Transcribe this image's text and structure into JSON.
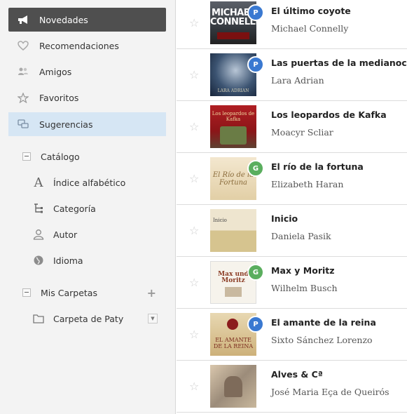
{
  "sidebar": {
    "nav": [
      {
        "label": "Novedades",
        "icon": "megaphone-icon"
      },
      {
        "label": "Recomendaciones",
        "icon": "heart-icon"
      },
      {
        "label": "Amigos",
        "icon": "users-icon"
      },
      {
        "label": "Favoritos",
        "icon": "star-icon"
      },
      {
        "label": "Sugerencias",
        "icon": "chat-bubbles-icon"
      }
    ],
    "catalog": {
      "label": "Catálogo",
      "items": [
        {
          "label": "Índice alfabético",
          "icon": "letter-a-icon"
        },
        {
          "label": "Categoría",
          "icon": "category-tree-icon"
        },
        {
          "label": "Autor",
          "icon": "person-icon"
        },
        {
          "label": "Idioma",
          "icon": "globe-icon"
        }
      ]
    },
    "folders": {
      "label": "Mis Carpetas",
      "items": [
        {
          "label": "Carpeta de Paty",
          "icon": "folder-icon"
        }
      ]
    }
  },
  "books": [
    {
      "title": "El último coyote",
      "author": "Michael Connelly",
      "badge": "P",
      "cover_text": "MICHAEL CONNELLY"
    },
    {
      "title": "Las puertas de la medianoche",
      "author": "Lara Adrian",
      "badge": "P",
      "cover_text": "LARA ADRIAN"
    },
    {
      "title": "Los leopardos de Kafka",
      "author": "Moacyr Scliar",
      "badge": "",
      "cover_text": "Los leopardos de Kafka"
    },
    {
      "title": "El río de la fortuna",
      "author": "Elizabeth Haran",
      "badge": "G",
      "cover_text": "El Río de la Fortuna"
    },
    {
      "title": "Inicio",
      "author": "Daniela Pasik",
      "badge": "",
      "cover_text": "Inicio"
    },
    {
      "title": "Max y Moritz",
      "author": "Wilhelm Busch",
      "badge": "G",
      "cover_text": "Max und Moritz"
    },
    {
      "title": "El amante de la reina",
      "author": "Sixto Sánchez Lorenzo",
      "badge": "P",
      "cover_text": "EL AMANTE DE LA REINA"
    },
    {
      "title": "Alves & Cª",
      "author": "José Maria Eça de Queirós",
      "badge": "",
      "cover_text": ""
    }
  ],
  "colors": {
    "active_nav": "#4f4f4f",
    "highlight_nav": "#d6e6f4",
    "badge_blue": "#3a79d1",
    "badge_green": "#5aae5e"
  }
}
